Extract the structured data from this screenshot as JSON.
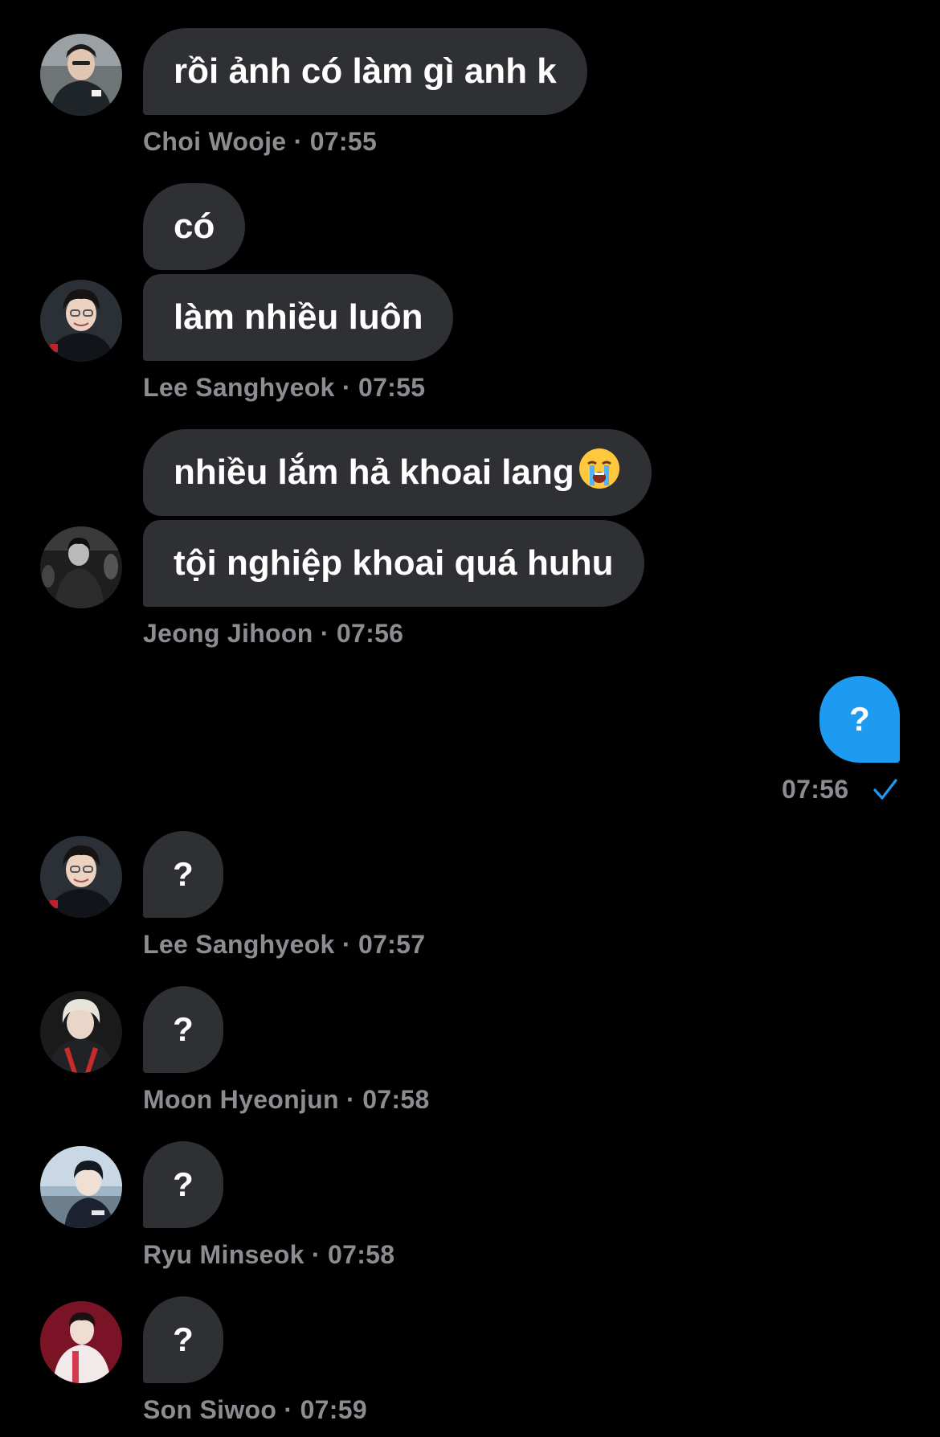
{
  "messages": [
    {
      "sender": "Choi Wooje",
      "text": "rồi ảnh có làm gì anh k",
      "meta": "Choi Wooje · 07:55"
    },
    {
      "sender": "Lee Sanghyeok",
      "text": "có"
    },
    {
      "sender": "Lee Sanghyeok",
      "text": "làm nhiều luôn",
      "meta": "Lee Sanghyeok  · 07:55"
    },
    {
      "sender": "Jeong Jihoon",
      "text": "nhiều lắm hả khoai lang",
      "emoji": "loudly-crying-face-emoji"
    },
    {
      "sender": "Jeong Jihoon",
      "text": "tội nghiệp khoai quá huhu",
      "meta": "Jeong Jihoon · 07:56"
    },
    {
      "sender": "me",
      "text": "?",
      "meta": "07:56"
    },
    {
      "sender": "Lee Sanghyeok",
      "text": "?",
      "meta": "Lee Sanghyeok  · 07:57"
    },
    {
      "sender": "Moon Hyeonjun",
      "text": "?",
      "meta": "Moon Hyeonjun · 07:58"
    },
    {
      "sender": "Ryu Minseok",
      "text": "?",
      "meta": "Ryu Minseok  · 07:58"
    },
    {
      "sender": "Son Siwoo",
      "text": "?",
      "meta": "Son Siwoo · 07:59"
    }
  ],
  "colors": {
    "background": "#000000",
    "incoming_bubble": "#2f3033",
    "outgoing_bubble": "#1d9bf0",
    "meta_text": "#8b8d91",
    "read_check": "#1d9bf0"
  },
  "icons": {
    "read_receipt": "checkmark-icon"
  }
}
